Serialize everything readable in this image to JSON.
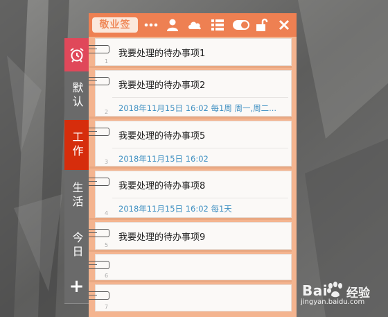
{
  "app": {
    "brand": "敬业签",
    "toolbar_icons": [
      "more-icon",
      "user-icon",
      "cloud-icon",
      "list-icon",
      "toggle-icon",
      "unlock-icon",
      "close-icon"
    ]
  },
  "tabs": [
    {
      "label": "",
      "icon": "alarm-clock-icon",
      "color": "#e0485a"
    },
    {
      "label": "默认",
      "color": "#6a6a6a"
    },
    {
      "label": "工作",
      "color": "#d62d0c"
    },
    {
      "label": "生活",
      "color": "#6a6a6a"
    },
    {
      "label": "今日",
      "color": "#6a6a6a"
    },
    {
      "label": "+",
      "color": "#6a6a6a"
    }
  ],
  "items": [
    {
      "num": "1",
      "title": "我要处理的待办事项1",
      "sub": ""
    },
    {
      "num": "2",
      "title": "我要处理的待办事项2",
      "sub": "2018年11月15日 16:02 每1周 周一,周二..."
    },
    {
      "num": "3",
      "title": "我要处理的待办事项5",
      "sub": "2018年11月15日 16:02"
    },
    {
      "num": "4",
      "title": "我要处理的待办事项8",
      "sub": "2018年11月15日 16:02 每1天"
    },
    {
      "num": "5",
      "title": "我要处理的待办事项9",
      "sub": ""
    },
    {
      "num": "6",
      "title": "",
      "sub": ""
    },
    {
      "num": "7",
      "title": "",
      "sub": ""
    }
  ],
  "watermark": {
    "logo": "Bai",
    "logo2": "经验",
    "url": "jingyan.baidu.com"
  }
}
